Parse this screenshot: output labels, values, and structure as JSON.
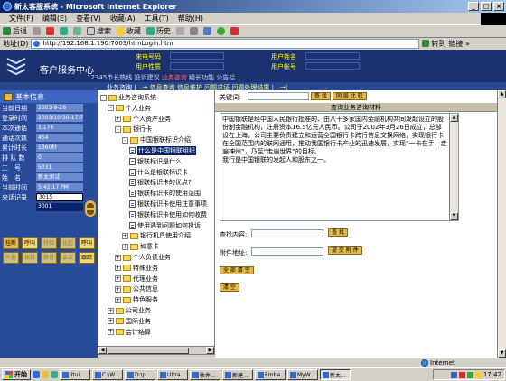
{
  "window": {
    "title": "新太客服系统 - Microsoft Internet Explorer",
    "min": "_",
    "max": "□",
    "close": "×"
  },
  "menu": [
    "文件(F)",
    "编辑(E)",
    "查看(V)",
    "收藏(A)",
    "工具(T)",
    "帮助(H)"
  ],
  "toolbar": {
    "back": "后退",
    "search": "搜索",
    "favorites": "收藏",
    "history": "历史"
  },
  "address": {
    "label": "地址(D)",
    "url": "http://192.168.1.190:7003/htmLogin.htm",
    "go": "转到",
    "links": "链接 »"
  },
  "header": {
    "title": "客户服务中心",
    "labels": [
      "来电号码",
      "用户姓名",
      "用户性质",
      "用户帐号"
    ],
    "links_prefix": "12345市长热线",
    "links": [
      "投诉建议",
      "业务咨询",
      "疑长功能",
      "公告栏"
    ],
    "sub_prefix": "业务咨询",
    "sub_items": [
      "信息查询",
      "信息维护",
      "问题求证",
      "问题处理结果"
    ]
  },
  "info": {
    "heading": "基本信息",
    "rows": [
      {
        "k": "当前日期",
        "v": "2003-9-28"
      },
      {
        "k": "登录时间",
        "v": "2003/10/30-17:7"
      },
      {
        "k": "本次通话",
        "v": "1,176"
      },
      {
        "k": "通话次数",
        "v": "454"
      },
      {
        "k": "累计时长",
        "v": "1360秒"
      },
      {
        "k": "排 队 数",
        "v": "0"
      },
      {
        "k": "工　号",
        "v": "5031"
      },
      {
        "k": "姓　名",
        "v": "新太测试"
      },
      {
        "k": "当前时间",
        "v": "5:42:17 PM"
      }
    ],
    "caller_label": "来话记录",
    "caller_values": [
      "3015",
      "3001"
    ],
    "buttons": [
      "挂断",
      "呼叫",
      "转接",
      "挂起",
      "呼叫",
      "外拨",
      "保持",
      "静音",
      "会议",
      "跟踪"
    ]
  },
  "tree": [
    {
      "label": "业务咨询系统",
      "level": 0,
      "type": "folder",
      "pm": "-"
    },
    {
      "label": "个人业务",
      "level": 1,
      "type": "folder",
      "pm": "-"
    },
    {
      "label": "个人资产业务",
      "level": 2,
      "type": "folder",
      "pm": "+"
    },
    {
      "label": "银行卡",
      "level": 2,
      "type": "folder",
      "pm": "-"
    },
    {
      "label": "中国银联标识介绍",
      "level": 3,
      "type": "folder",
      "pm": "-"
    },
    {
      "label": "什么是中国银联组织",
      "level": 4,
      "type": "doc",
      "selected": true
    },
    {
      "label": "银联标识是什么",
      "level": 4,
      "type": "doc"
    },
    {
      "label": "什么是银联标识卡",
      "level": 4,
      "type": "doc"
    },
    {
      "label": "银联标识卡的优点?",
      "level": 4,
      "type": "doc"
    },
    {
      "label": "银联标识卡的使用范围",
      "level": 4,
      "type": "doc"
    },
    {
      "label": "银联标识卡使用注意事项",
      "level": 4,
      "type": "doc"
    },
    {
      "label": "银联标识卡使用如何收费",
      "level": 4,
      "type": "doc"
    },
    {
      "label": "使用遇到问题如何投诉",
      "level": 4,
      "type": "doc"
    },
    {
      "label": "银行机具使用介绍",
      "level": 3,
      "type": "folder",
      "pm": "+"
    },
    {
      "label": "如意卡",
      "level": 3,
      "type": "folder",
      "pm": "+"
    },
    {
      "label": "个人负债业务",
      "level": 2,
      "type": "folder",
      "pm": "+"
    },
    {
      "label": "特殊业务",
      "level": 2,
      "type": "folder",
      "pm": "+"
    },
    {
      "label": "代理业务",
      "level": 2,
      "type": "folder",
      "pm": "+"
    },
    {
      "label": "公共信息",
      "level": 2,
      "type": "folder",
      "pm": "+"
    },
    {
      "label": "特色服务",
      "level": 2,
      "type": "folder",
      "pm": "+"
    },
    {
      "label": "公司业务",
      "level": 1,
      "type": "folder",
      "pm": "+"
    },
    {
      "label": "国际业务",
      "level": 1,
      "type": "folder",
      "pm": "+"
    },
    {
      "label": "会计结算",
      "level": 1,
      "type": "folder",
      "pm": "+"
    }
  ],
  "content": {
    "keyword_label": "关键词:",
    "search_btn": "查 找",
    "same_btn": "同 层 比 较",
    "result_head": "查询业务咨询材料",
    "body": "中国银联是经中国人民银行批准的、由八十多家国内金融机构共同发起设立的股份制金融机构，注册资本16.5亿元人民币。公司于2002年3月26日成立，总部设在上海。公司主要负责建立和运营全国银行卡跨行信息交换网络，实现银行卡在全国范围内的联网通用，推动我国银行卡产业的迅速发展，实现“一卡在手，走遍神州”，乃至“走遍世界”的目标。\n我行是中国银联的发起人和股东之一。",
    "query_label": "查找内容:",
    "query_btn": "查 找",
    "attach_label": "附件地址:",
    "attach_btn": "提 交 附 件",
    "clear_btn": "全 部 清 空",
    "submit_btn": "清 空"
  },
  "status": {
    "zone": "Internet"
  },
  "taskbar": {
    "start": "开始",
    "tasks": [
      "Jitui...",
      "C:\\W...",
      "D:\\p...",
      "Ultra...",
      "收件...",
      "新建...",
      "Emba...",
      "MyW...",
      "新太..."
    ],
    "time": "17:42"
  }
}
